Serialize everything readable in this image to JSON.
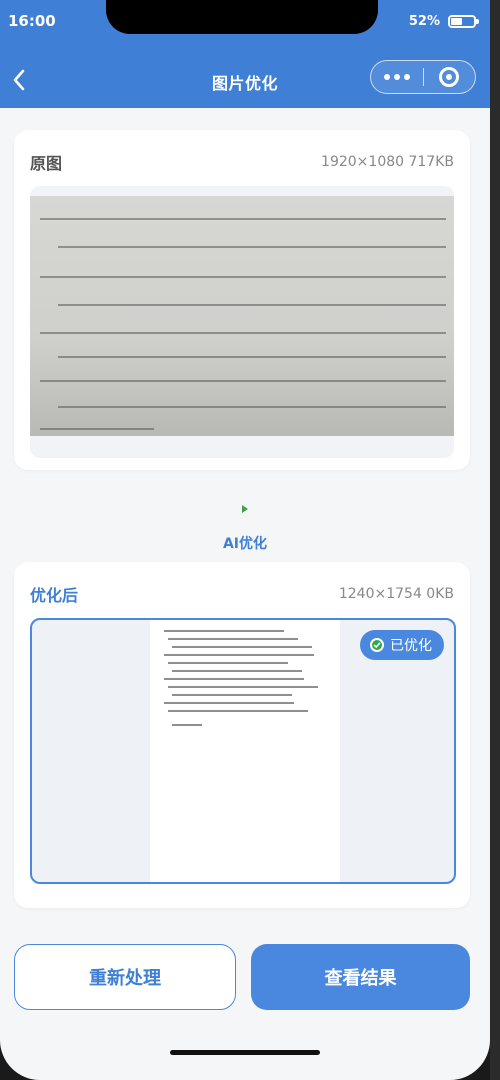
{
  "status_bar": {
    "time": "16:00",
    "battery": "52%",
    "battery_level": 0.52
  },
  "header": {
    "title": "图片优化",
    "back_icon": "chevron-left-icon",
    "more_icon": "more-dots-icon",
    "close_icon": "target-circle-icon"
  },
  "original": {
    "title": "原图",
    "meta": "1920×1080 717KB"
  },
  "transition": {
    "arrow_icon": "play-arrow-icon",
    "label": "AI优化"
  },
  "optimized": {
    "title": "优化后",
    "meta": "1240×1754 0KB",
    "badge": "已优化",
    "badge_icon": "check-circle-icon"
  },
  "actions": {
    "reprocess": "重新处理",
    "view_result": "查看结果"
  },
  "colors": {
    "primary": "#3f7fd6",
    "success": "#2ea84a",
    "background": "#f5f6f8"
  }
}
